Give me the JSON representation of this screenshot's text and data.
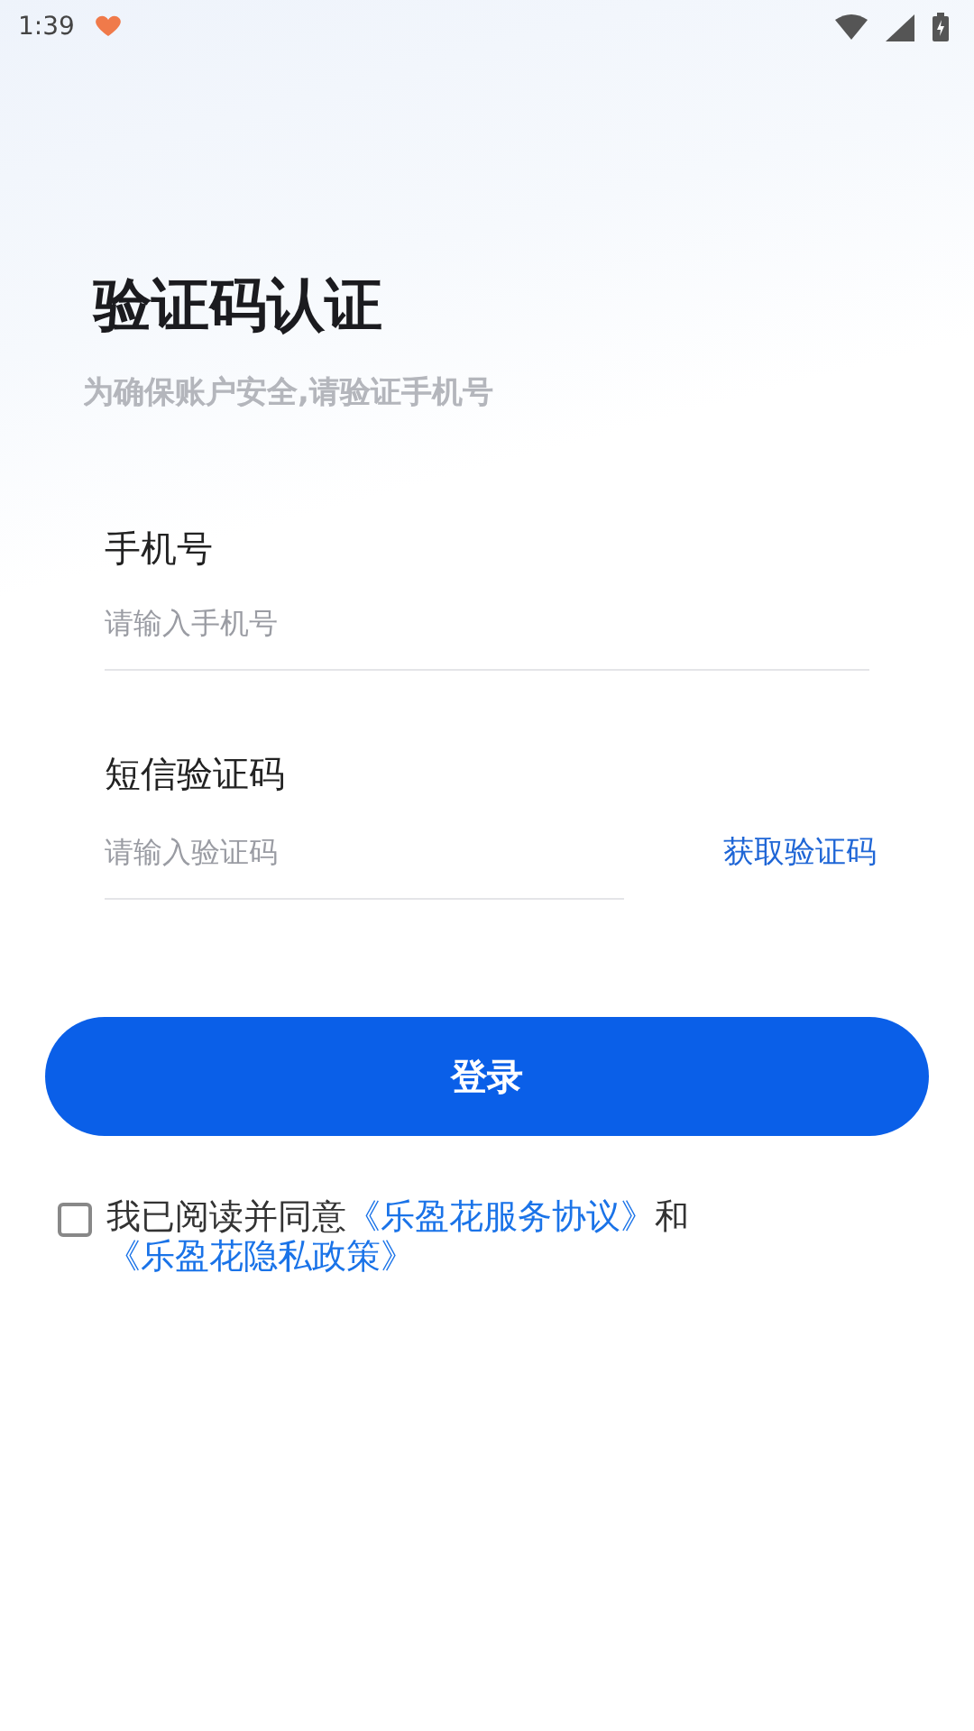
{
  "status_bar": {
    "time": "1:39"
  },
  "header": {
    "title": "验证码认证",
    "subtitle": "为确保账户安全,请验证手机号"
  },
  "fields": [
    {
      "label": "手机号",
      "placeholder": "请输入手机号"
    },
    {
      "label": "短信验证码",
      "placeholder": "请输入验证码",
      "action": "获取验证码"
    }
  ],
  "login_button": "登录",
  "agreement": {
    "checked": false,
    "text": "我已阅读并同意",
    "links": [
      "《乐盈花服务协议》",
      "《乐盈花隐私政策》"
    ],
    "joiner": "和"
  }
}
